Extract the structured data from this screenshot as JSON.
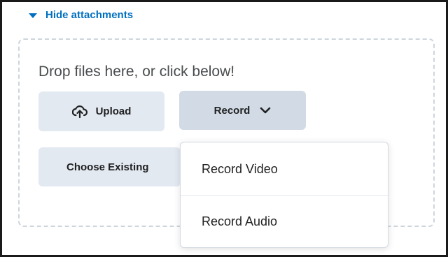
{
  "attachments": {
    "toggle_label": "Hide attachments",
    "dropzone_text": "Drop files here, or click below!"
  },
  "buttons": {
    "upload_label": "Upload",
    "record_label": "Record",
    "choose_existing_label": "Choose Existing"
  },
  "record_menu": {
    "items": [
      {
        "label": "Record Video"
      },
      {
        "label": "Record Audio"
      }
    ]
  },
  "colors": {
    "link": "#006fbf",
    "button_bg": "#e3e9f1",
    "button_active_bg": "#d2dbe5",
    "dropzone_border": "#cdd5dc",
    "text": "#202122"
  },
  "icons": {
    "toggle": "caret-down-icon",
    "upload": "cloud-upload-icon",
    "record": "chevron-down-icon"
  }
}
